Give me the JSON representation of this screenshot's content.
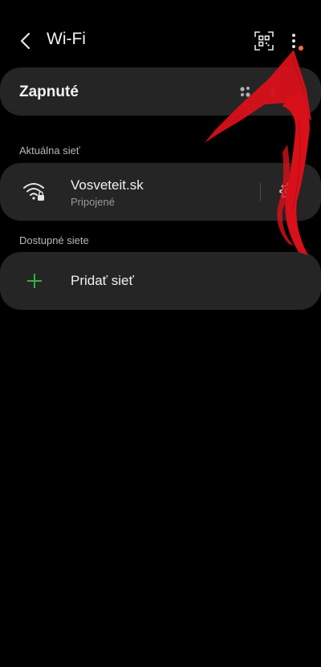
{
  "header": {
    "title": "Wi-Fi",
    "back_icon": "chevron-left-icon",
    "qr_icon": "qr-code-scan-icon",
    "more_icon": "more-vertical-icon",
    "notification_dot_color": "#ff6b3d"
  },
  "toggle": {
    "label": "Zapnuté",
    "state": "on"
  },
  "current_network": {
    "section_label": "Aktuálna sieť",
    "name": "Vosveteit.sk",
    "status": "Pripojené",
    "icon": "wifi-lock-icon",
    "settings_icon": "gear-icon"
  },
  "available": {
    "section_label": "Dostupné siete",
    "add_label": "Pridať sieť",
    "add_icon": "plus-icon",
    "add_icon_color": "#2fb14a"
  },
  "annotation": {
    "arrow_color": "#d8101a"
  }
}
